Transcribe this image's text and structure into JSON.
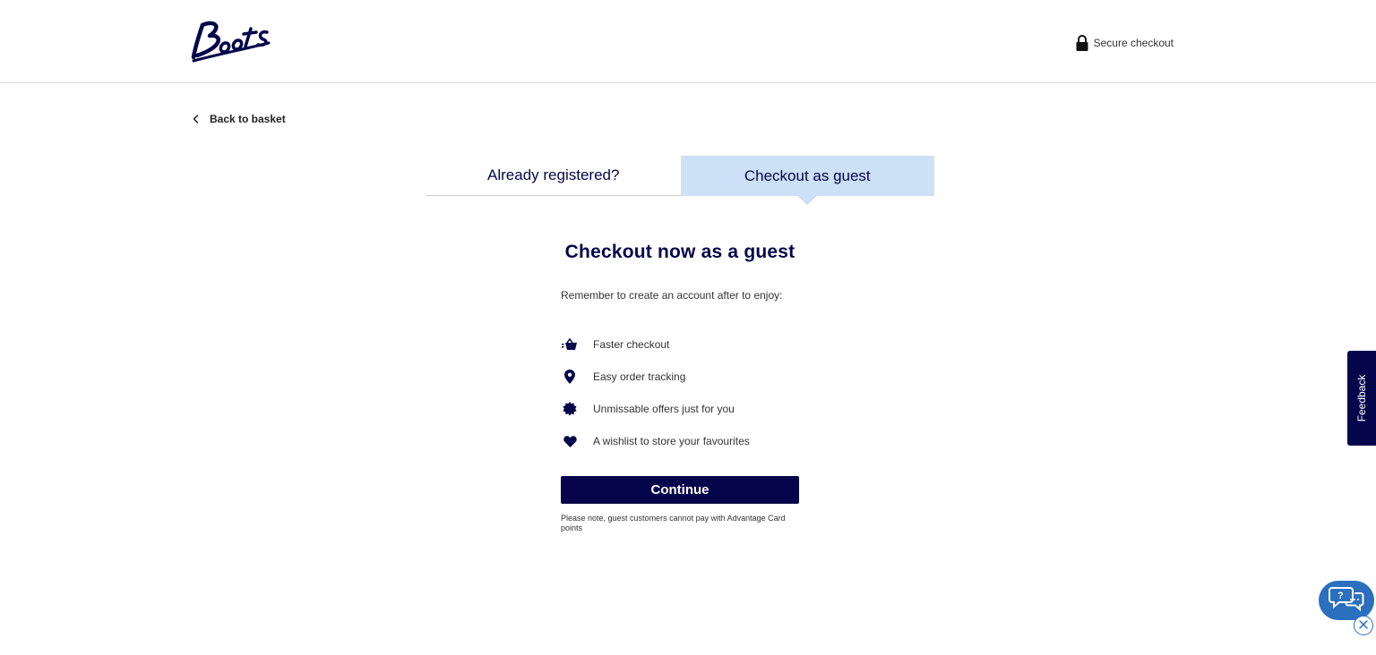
{
  "header": {
    "logo_alt": "Boots",
    "secure_label": "Secure checkout",
    "secure_icon": "lock-icon"
  },
  "nav": {
    "back_label": "Back to basket",
    "back_icon": "chevron-left-icon"
  },
  "tabs": [
    {
      "label": "Already registered?",
      "active": false
    },
    {
      "label": "Checkout as guest",
      "active": true
    }
  ],
  "guest": {
    "title": "Checkout now as a guest",
    "intro": "Remember to create an account after to enjoy:",
    "benefits": [
      {
        "icon": "basket-icon",
        "label": "Faster checkout"
      },
      {
        "icon": "location-pin-icon",
        "label": "Easy order tracking"
      },
      {
        "icon": "offer-badge-icon",
        "label": "Unmissable offers just for you"
      },
      {
        "icon": "heart-icon",
        "label": "A wishlist to store your favourites"
      }
    ],
    "continue_label": "Continue",
    "note": "Please note, guest customers cannot pay with Advantage Card points"
  },
  "feedback": {
    "label": "Feedback"
  },
  "colors": {
    "brand_navy": "#05054b",
    "tab_active_bg": "#cce1f5",
    "chat_blue": "#2b6fbf"
  }
}
